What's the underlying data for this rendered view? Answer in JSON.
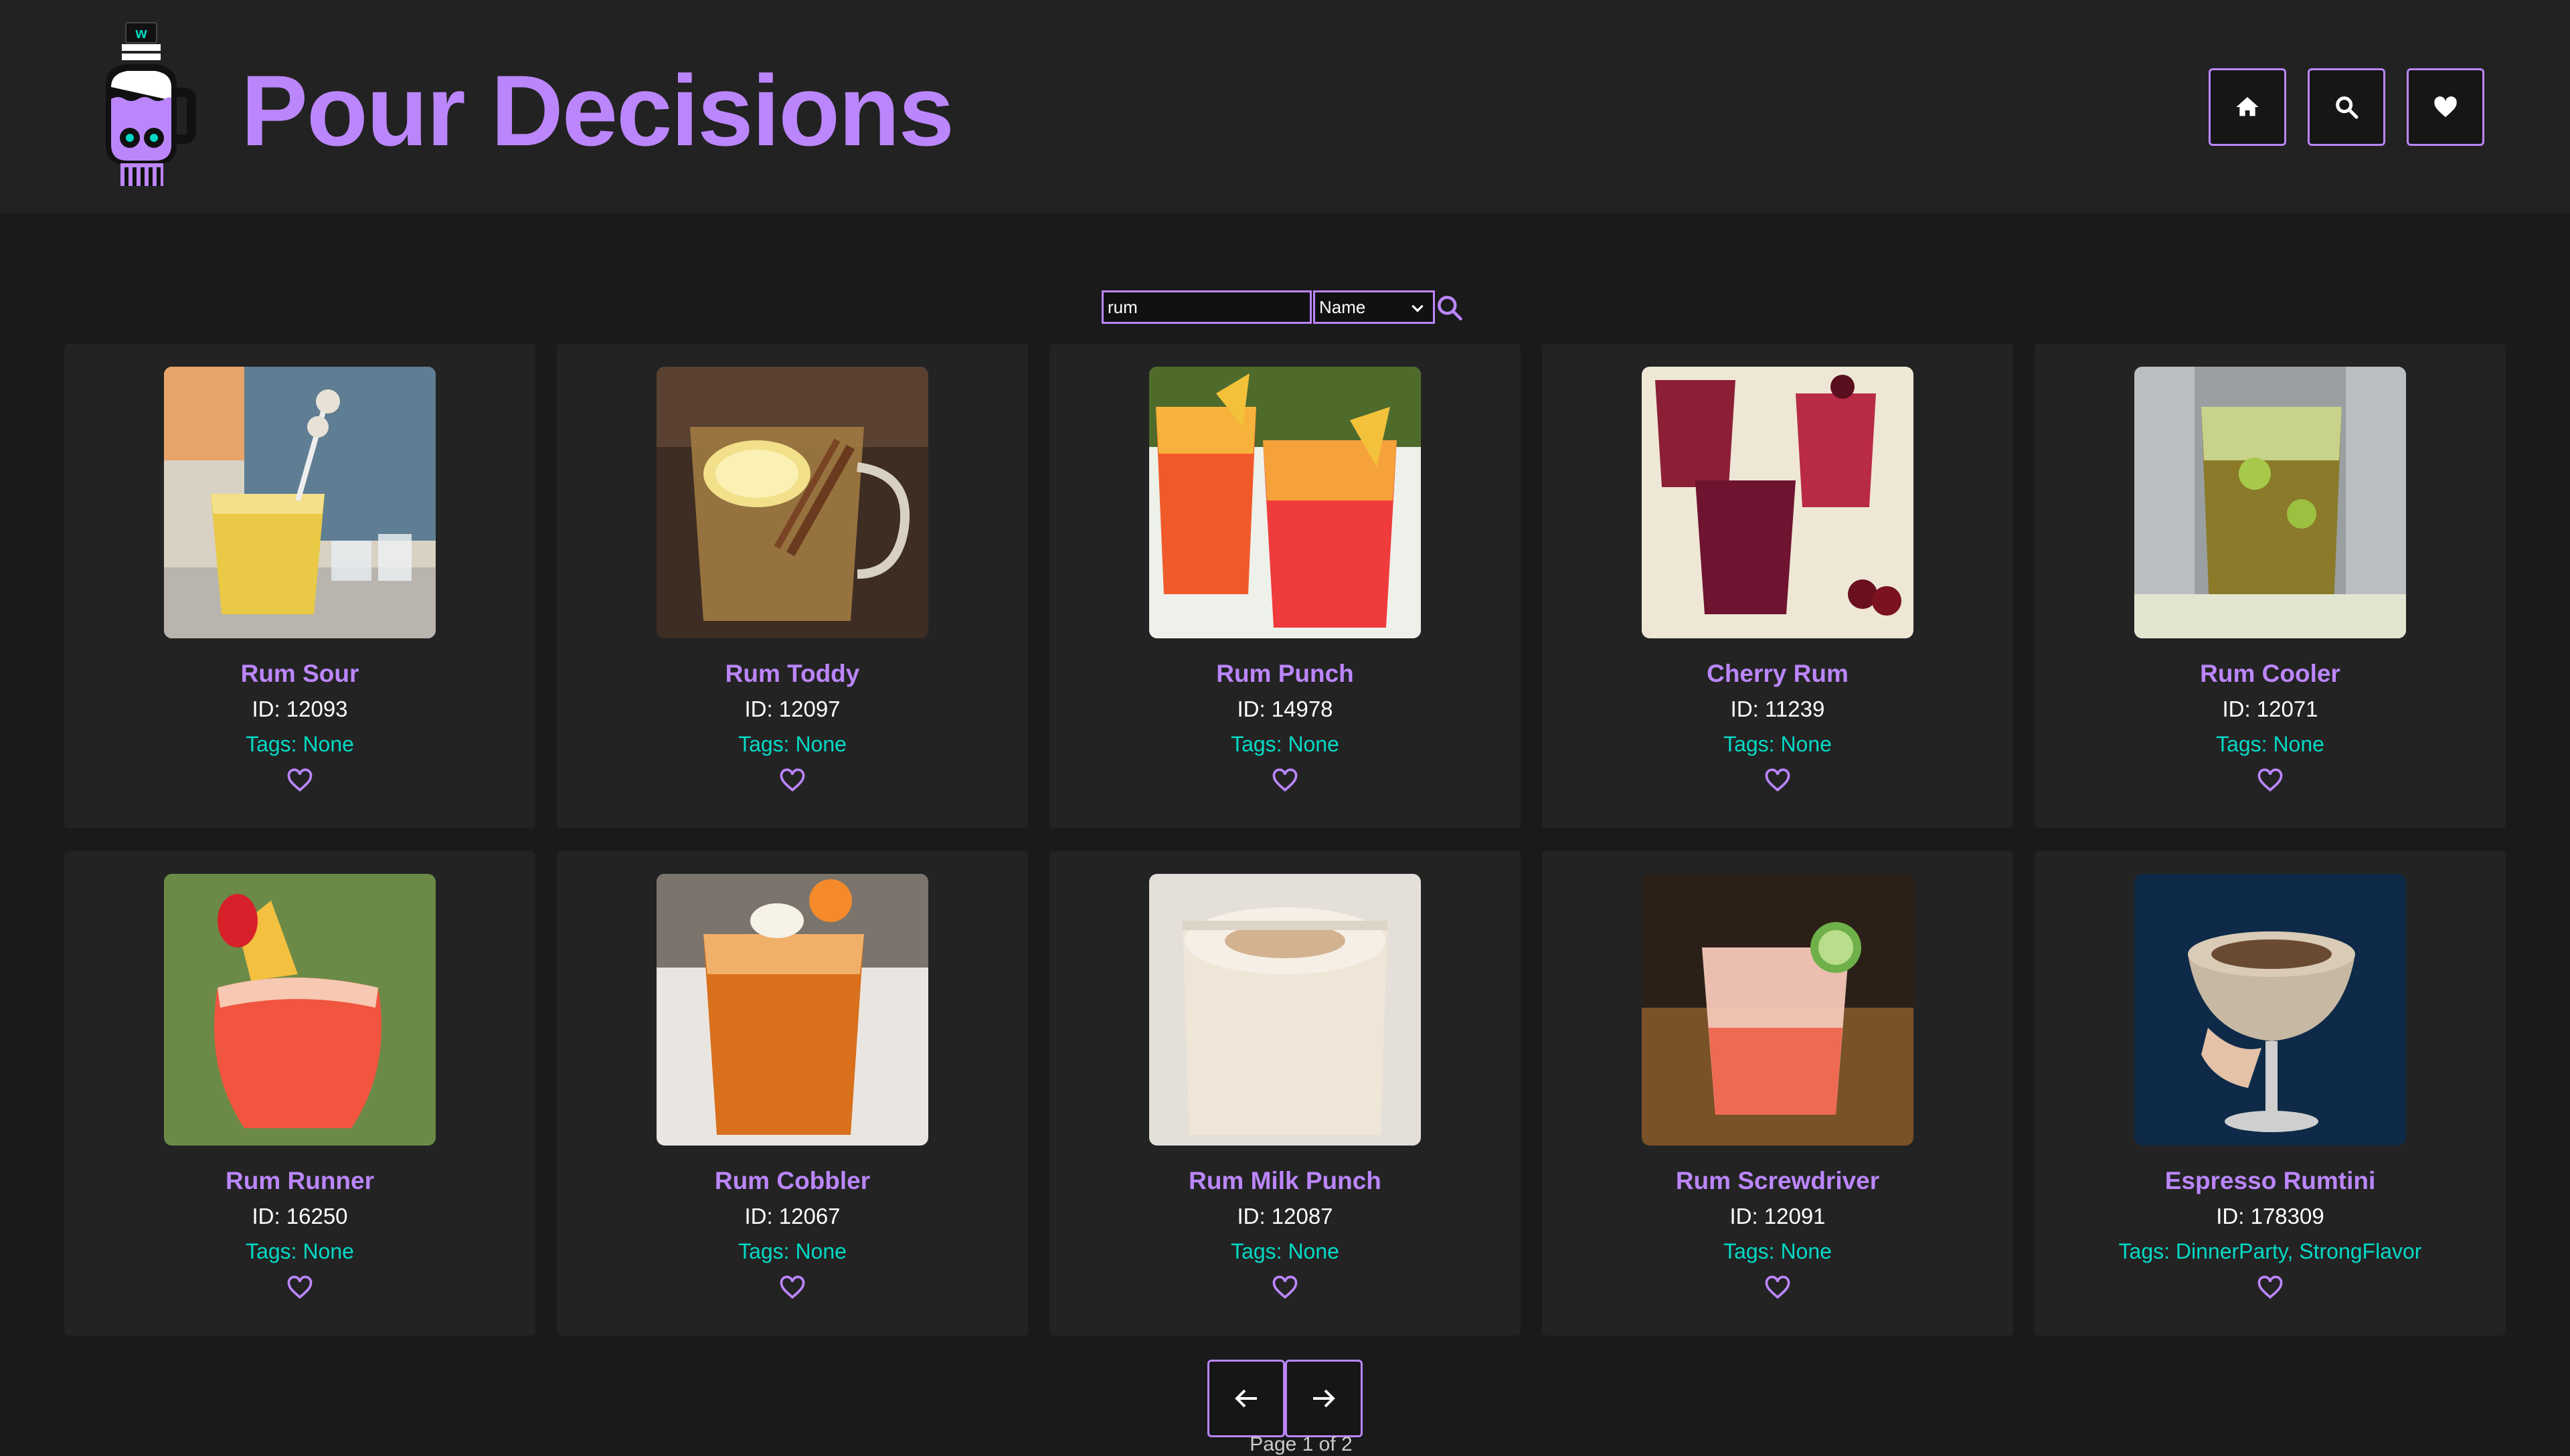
{
  "header": {
    "brand": "Pour Decisions",
    "logo_icon": "skull-flask-logo-icon",
    "nav": [
      {
        "icon": "home-icon"
      },
      {
        "icon": "search-icon"
      },
      {
        "icon": "heart-icon"
      }
    ]
  },
  "search": {
    "query": "rum",
    "filter_selected": "Name",
    "filter_icon": "chevron-down-icon",
    "submit_icon": "search-icon"
  },
  "results": [
    {
      "name": "Rum Sour",
      "id": "ID: 12093",
      "tags": "Tags: None"
    },
    {
      "name": "Rum Toddy",
      "id": "ID: 12097",
      "tags": "Tags: None"
    },
    {
      "name": "Rum Punch",
      "id": "ID: 14978",
      "tags": "Tags: None"
    },
    {
      "name": "Cherry Rum",
      "id": "ID: 11239",
      "tags": "Tags: None"
    },
    {
      "name": "Rum Cooler",
      "id": "ID: 12071",
      "tags": "Tags: None"
    },
    {
      "name": "Rum Runner",
      "id": "ID: 16250",
      "tags": "Tags: None"
    },
    {
      "name": "Rum Cobbler",
      "id": "ID: 12067",
      "tags": "Tags: None"
    },
    {
      "name": "Rum Milk Punch",
      "id": "ID: 12087",
      "tags": "Tags: None"
    },
    {
      "name": "Rum Screwdriver",
      "id": "ID: 12091",
      "tags": "Tags: None"
    },
    {
      "name": "Espresso Rumtini",
      "id": "ID: 178309",
      "tags": "Tags: DinnerParty, StrongFlavor"
    }
  ],
  "pagination": {
    "prev_icon": "arrow-left-icon",
    "next_icon": "arrow-right-icon",
    "page_info": "Page 1 of 2"
  },
  "colors": {
    "accent": "#bb86fc",
    "tag": "#03dac6",
    "background": "#1a1a1a",
    "header": "#222222",
    "card": "#232323"
  }
}
